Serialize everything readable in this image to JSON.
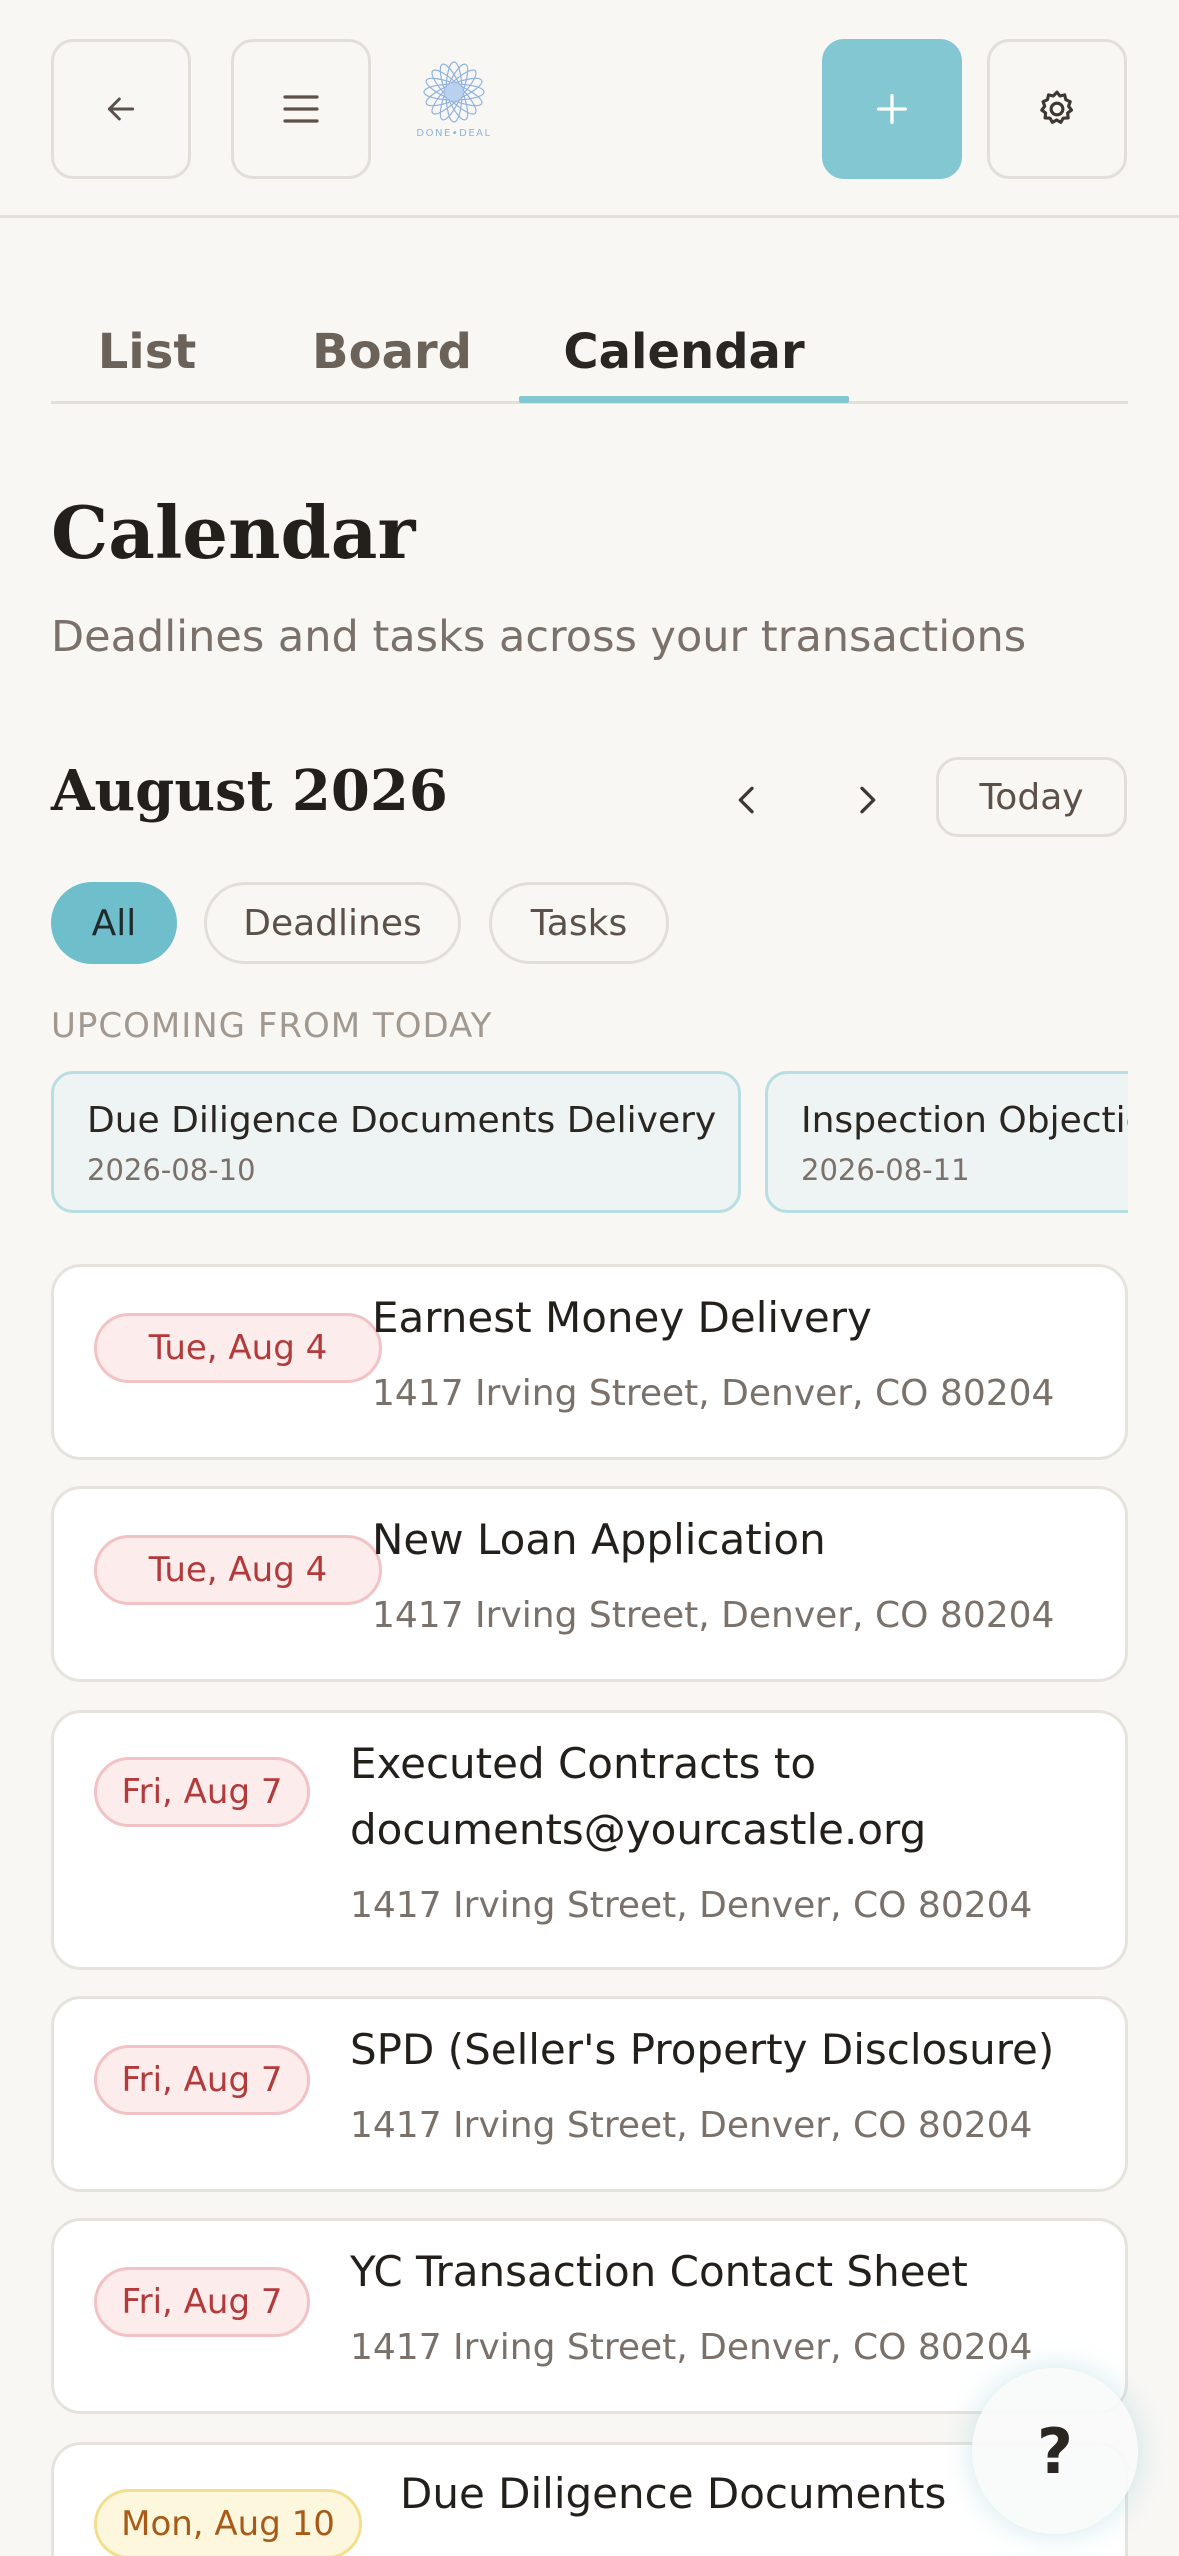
{
  "header": {
    "logo_text": "DONE•DEAL",
    "icons": {
      "back": "arrow-left-icon",
      "menu": "hamburger-menu-icon",
      "add": "plus-icon",
      "settings": "gear-icon"
    },
    "accent_color": "#82c7d1"
  },
  "tabs": [
    {
      "label": "List",
      "active": false
    },
    {
      "label": "Board",
      "active": false
    },
    {
      "label": "Calendar",
      "active": true
    }
  ],
  "page": {
    "title": "Calendar",
    "subtitle": "Deadlines and tasks across your transactions"
  },
  "calendar": {
    "month_label": "August 2026",
    "today_label": "Today",
    "filters": [
      {
        "label": "All",
        "active": true
      },
      {
        "label": "Deadlines",
        "active": false
      },
      {
        "label": "Tasks",
        "active": false
      }
    ]
  },
  "upcoming": {
    "label": "UPCOMING FROM TODAY",
    "items": [
      {
        "title": "Due Diligence Documents Delivery",
        "date": "2026-08-10"
      },
      {
        "title": "Inspection Objection",
        "date": "2026-08-11"
      }
    ]
  },
  "events": [
    {
      "date": "Tue, Aug 4",
      "title": "Earnest Money Delivery",
      "title_line2": "",
      "address": "1417 Irving Street, Denver, CO 80204",
      "badge_color": "red"
    },
    {
      "date": "Tue, Aug 4",
      "title": "New Loan Application",
      "title_line2": "",
      "address": "1417 Irving Street, Denver, CO 80204",
      "badge_color": "red"
    },
    {
      "date": "Fri, Aug 7",
      "title": "Executed Contracts to",
      "title_line2": "documents@yourcastle.org",
      "address": "1417 Irving Street, Denver, CO 80204",
      "badge_color": "red"
    },
    {
      "date": "Fri, Aug 7",
      "title": "SPD (Seller's Property Disclosure)",
      "title_line2": "",
      "address": "1417 Irving Street, Denver, CO 80204",
      "badge_color": "red"
    },
    {
      "date": "Fri, Aug 7",
      "title": "YC Transaction Contact Sheet",
      "title_line2": "",
      "address": "1417 Irving Street, Denver, CO 80204",
      "badge_color": "red"
    },
    {
      "date": "Mon, Aug 10",
      "title": "Due Diligence Documents",
      "title_line2": "",
      "address": "",
      "badge_color": "yellow"
    }
  ],
  "help": {
    "label": "?"
  }
}
